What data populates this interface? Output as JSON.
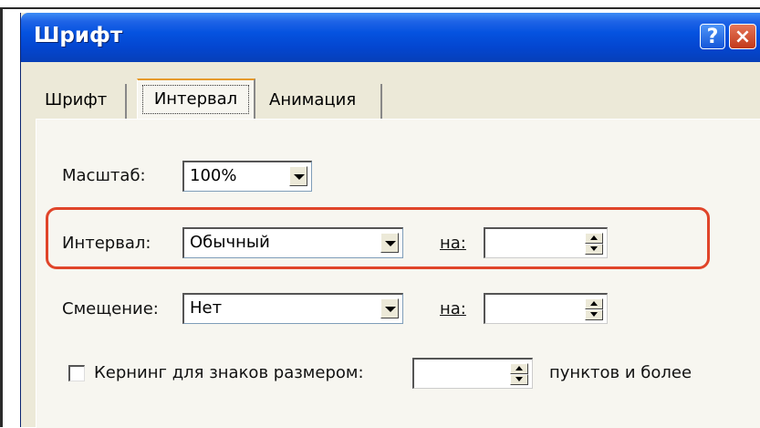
{
  "window": {
    "title": "Шрифт",
    "help_label": "?",
    "close_label": "×"
  },
  "tabs": [
    {
      "label": "Шрифт",
      "active": false
    },
    {
      "label": "Интервал",
      "active": true
    },
    {
      "label": "Анимация",
      "active": false
    }
  ],
  "scale": {
    "label": "Масштаб:",
    "value": "100%"
  },
  "spacing": {
    "label": "Интервал:",
    "value": "Обычный",
    "by_label": "на:",
    "by_value": ""
  },
  "position": {
    "label": "Смещение:",
    "value": "Нет",
    "by_label": "на:",
    "by_value": ""
  },
  "kerning": {
    "label": "Кернинг для знаков размером:",
    "checked": false,
    "value": "",
    "suffix": "пунктов и более"
  },
  "colors": {
    "titlebar": "#0553e0",
    "highlight": "#e0452a",
    "dialog_bg": "#ece9d8"
  }
}
